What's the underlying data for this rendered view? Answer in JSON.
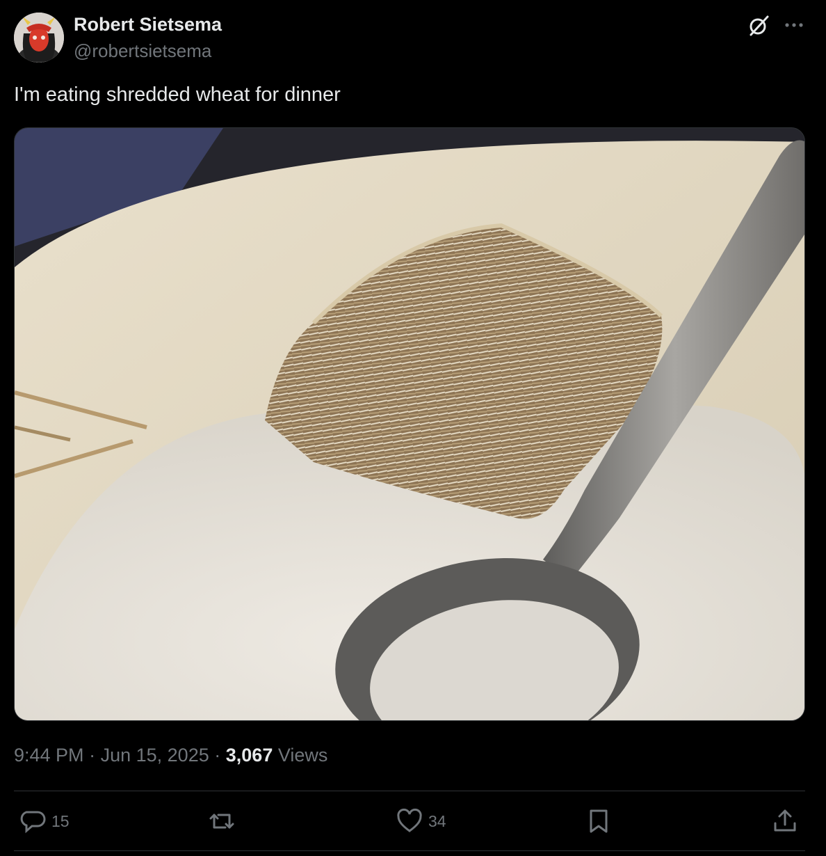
{
  "author": {
    "display_name": "Robert Sietsema",
    "handle": "@robertsietsema",
    "avatar_icon": "avatar"
  },
  "header_icons": {
    "grok": "grok-icon",
    "more": "more-icon"
  },
  "tweet": {
    "text": "I'm eating shredded wheat for dinner"
  },
  "meta": {
    "time": "9:44 PM",
    "sep1": "·",
    "date": "Jun 15, 2025",
    "sep2": "·",
    "views_count": "3,067",
    "views_label": "Views"
  },
  "actions": {
    "replies": "15",
    "likes": "34"
  },
  "colors": {
    "background": "#000000",
    "text": "#e7e9ea",
    "muted": "#71767b",
    "divider": "#2f3336"
  }
}
